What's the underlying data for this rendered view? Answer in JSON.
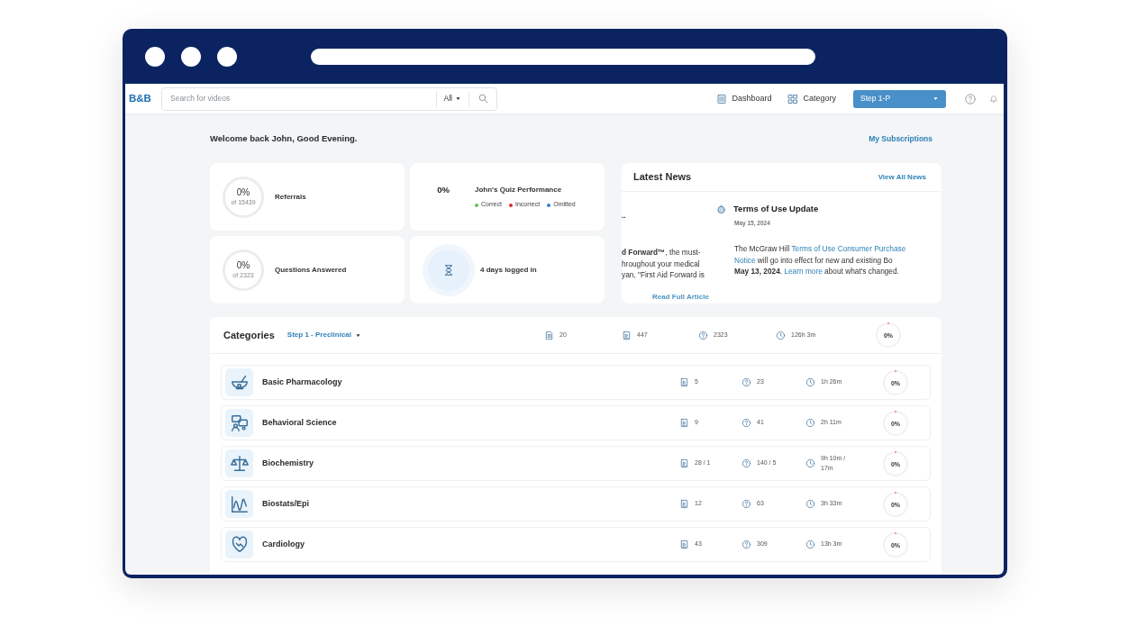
{
  "navbar": {
    "logo": "B&B",
    "search": {
      "placeholder": "Search for videos"
    },
    "filter": "All",
    "links": [
      {
        "label": "Dashboard",
        "kind": "dashboard"
      },
      {
        "label": "Category",
        "kind": "grid"
      }
    ],
    "step_select": "Step 1-P"
  },
  "welcome": "Welcome back John, Good Evening.",
  "subscriptions_link": "My Subscriptions",
  "stats": [
    {
      "kind": "ring",
      "value": "0%",
      "sub": "of 15439",
      "label": "Referrals"
    },
    {
      "kind": "quiz",
      "value": "0%",
      "label": "John's Quiz Performance",
      "legend": [
        {
          "label": "Correct",
          "color": "#5cc94a"
        },
        {
          "label": "Incorrect",
          "color": "#d9302c"
        },
        {
          "label": "Omitted",
          "color": "#2f7fd6"
        }
      ]
    },
    {
      "kind": "ring",
      "value": "0%",
      "sub": "of 2323",
      "label": "Questions Answered"
    },
    {
      "kind": "hourglass",
      "label": "4 days logged in"
    }
  ],
  "news": {
    "title": "Latest News",
    "view_all": "View All News",
    "left_slide": {
      "title": "..",
      "lines": [
        "**d Forward™**, the must-",
        "hroughout your medical",
        "yan, \"First Aid Forward is"
      ],
      "link": "Read Full Article"
    },
    "right_slide": {
      "title": "Terms of Use Update",
      "date": "May 15, 2024",
      "lines": [
        [
          {
            "kind": "text",
            "text": "The McGraw Hill "
          },
          {
            "kind": "link",
            "text": "Terms of Use Consumer Purchase"
          }
        ],
        [
          {
            "kind": "link",
            "text": "Notice"
          },
          {
            "kind": "text",
            "text": " will go into effect for new and existing Bo"
          }
        ],
        [
          {
            "kind": "bold",
            "text": "May 13, 2024"
          },
          {
            "kind": "text",
            "text": ". "
          },
          {
            "kind": "link",
            "text": "Learn more"
          },
          {
            "kind": "text",
            "text": " about what's changed."
          }
        ]
      ]
    }
  },
  "categories": {
    "title": "Categories",
    "step": "Step 1 - Preclinical",
    "totals": {
      "documents": "20",
      "videos": "447",
      "questions": "2323",
      "time": "126h 3m",
      "percent": "0%"
    },
    "rows": [
      {
        "kind": "pharmacology",
        "name": "Basic Pharmacology",
        "videos": "5",
        "questions": "23",
        "time": "1h 26m",
        "percent": "0%"
      },
      {
        "kind": "behavioral",
        "name": "Behavioral Science",
        "videos": "9",
        "questions": "41",
        "time": "2h 11m",
        "percent": "0%"
      },
      {
        "kind": "biochemistry",
        "name": "Biochemistry",
        "videos": "28 / 1",
        "questions": "140 / 5",
        "time": "9h 10m / 17m",
        "percent": "0%"
      },
      {
        "kind": "biostats",
        "name": "Biostats/Epi",
        "videos": "12",
        "questions": "63",
        "time": "3h 33m",
        "percent": "0%"
      },
      {
        "kind": "cardiology",
        "name": "Cardiology",
        "videos": "43",
        "questions": "309",
        "time": "13h 3m",
        "percent": "0%"
      }
    ]
  }
}
